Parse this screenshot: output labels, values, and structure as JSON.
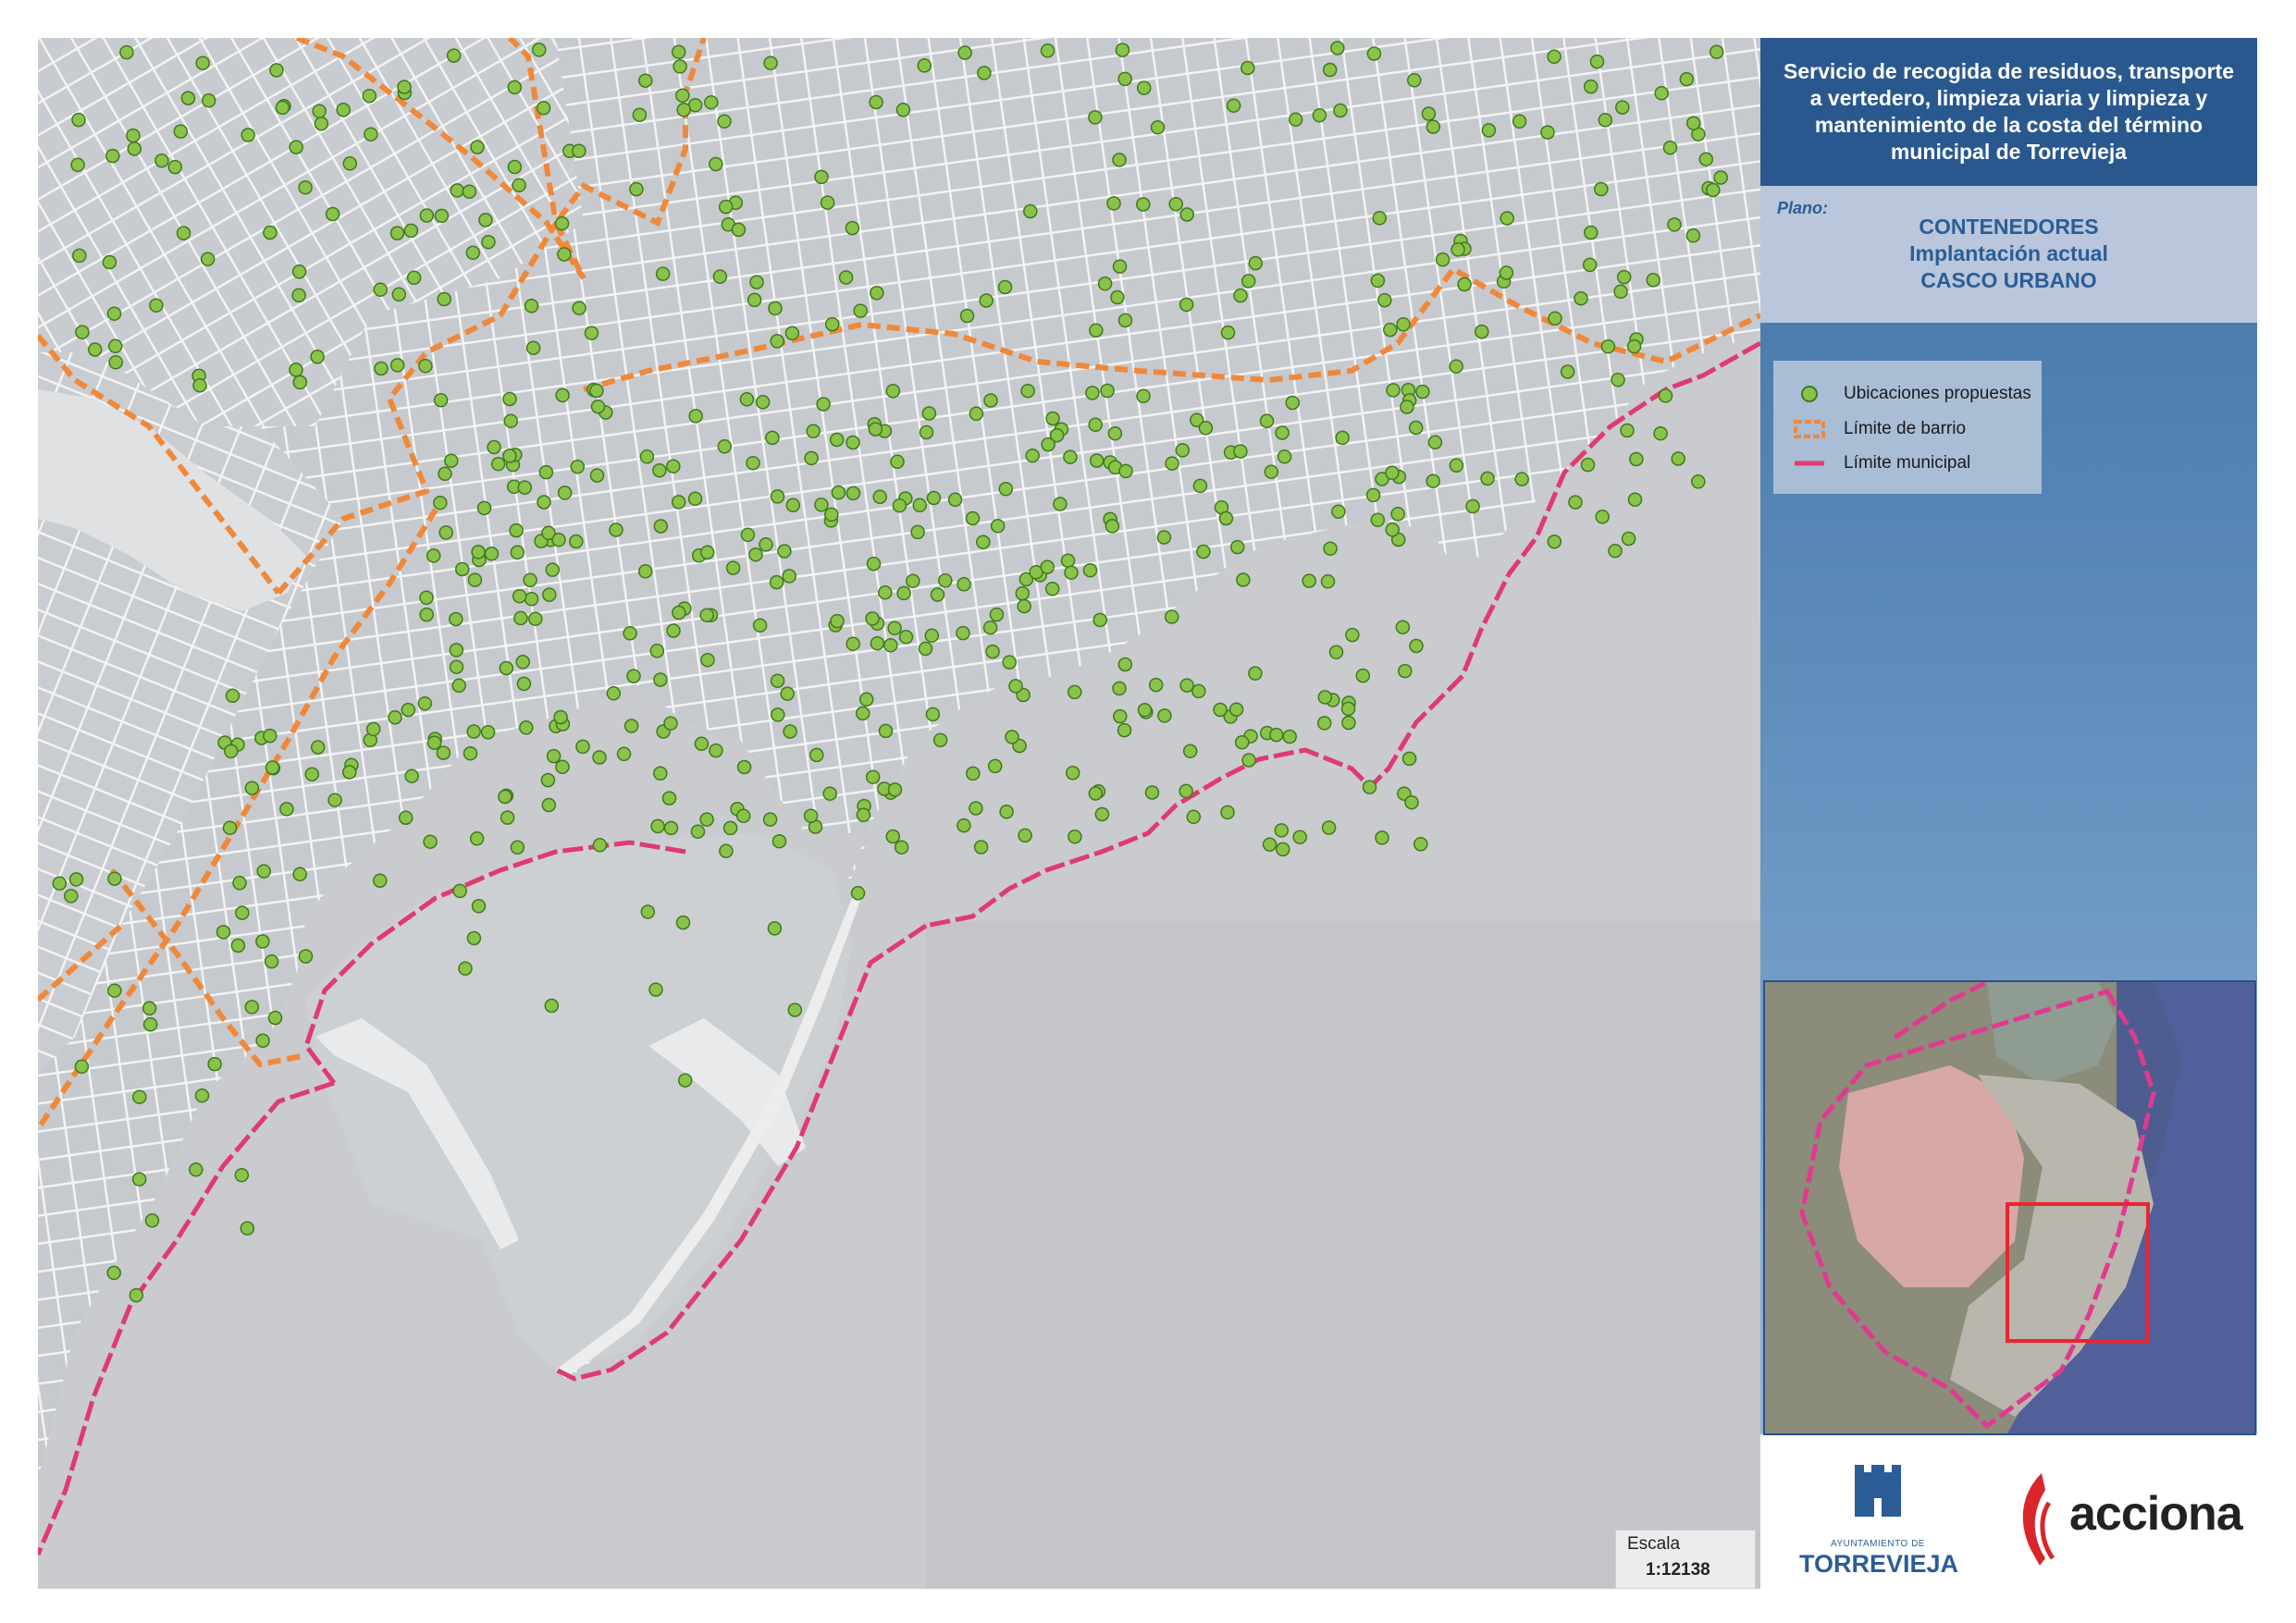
{
  "panel": {
    "title": "Servicio de recogida de residuos, transporte a vertedero, limpieza viaria y limpieza y mantenimiento de la costa del término municipal de Torrevieja",
    "plano_label": "Plano:",
    "plano_lines": [
      "CONTENEDORES",
      "Implantación actual",
      "CASCO URBANO"
    ]
  },
  "legend": {
    "items": [
      {
        "label": "Ubicaciones propuestas",
        "symbol": "green-dot"
      },
      {
        "label": "Límite de barrio",
        "symbol": "orange-dashed-box"
      },
      {
        "label": "Límite municipal",
        "symbol": "magenta-line"
      }
    ]
  },
  "scale": {
    "label": "Escala",
    "value": "1:12138"
  },
  "logos": {
    "torrevieja_small": "AYUNTAMIENTO DE",
    "torrevieja_big": "TORREVIEJA",
    "acciona": "acciona"
  },
  "colors": {
    "land": "#d2d5d8",
    "block": "#c3c6ca",
    "street": "#f4f5f6",
    "sea": "#c9cbce",
    "container_fill": "#8bc34a",
    "container_stroke": "#3d7a1e",
    "barrio_line": "#f0883a",
    "municipal_line": "#e03a73",
    "panel_title_bg": "#29588f"
  },
  "map_features": {
    "container_locations": "green dots spread over the urban centre",
    "inset": "overview of the municipality with the urban centre highlighted by a red rectangle"
  }
}
